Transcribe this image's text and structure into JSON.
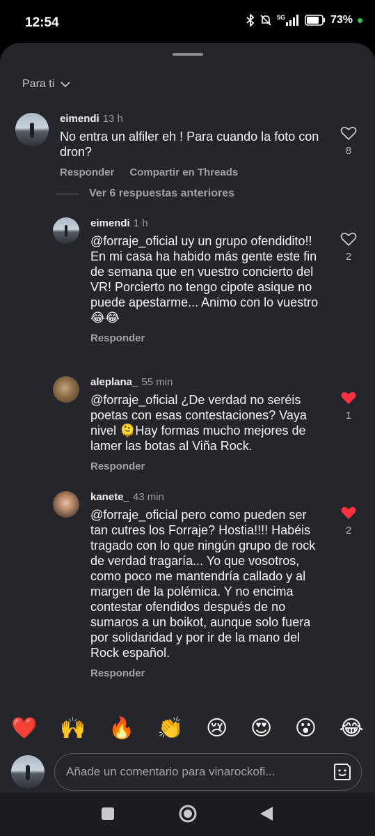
{
  "status": {
    "time": "12:54",
    "battery": "73%",
    "network": "5G"
  },
  "filter": {
    "label": "Para ti"
  },
  "comments": [
    {
      "user": "eimendi",
      "time": "13 h",
      "text": "No entra un alfiler eh ! Para cuando la foto con dron?",
      "reply_label": "Responder",
      "share_label": "Compartir en Threads",
      "likes": "8",
      "liked": false
    }
  ],
  "more_replies": {
    "label": "Ver 6 respuestas anteriores"
  },
  "replies": [
    {
      "user": "eimendi",
      "time": "1 h",
      "mention": "@forraje_oficial",
      "text": " uy un grupo ofendidito!! En mi casa ha habido más gente este fin de semana que en vuestro concierto del VR! Porcierto no tengo cipote asique no puede apestarme... Animo con lo vuestro 😂😂",
      "reply_label": "Responder",
      "likes": "2",
      "liked": false
    },
    {
      "user": "aleplana_",
      "time": "55 min",
      "mention": "@forraje_oficial",
      "text": " ¿De verdad no seréis poetas con esas contestaciones? Vaya nivel 🫠Hay formas mucho mejores de lamer las botas al Viña Rock.",
      "reply_label": "Responder",
      "likes": "1",
      "liked": true
    },
    {
      "user": "kanete_",
      "time": "43 min",
      "mention": "@forraje_oficial",
      "text": " pero como pueden ser tan cutres los Forraje? Hostia!!!! Habéis tragado con lo que ningún grupo de rock de verdad tragaría... Yo que vosotros, como poco me mantendría callado y al margen de la polémica. Y no encima contestar ofendidos después de no sumaros a un boikot, aunque solo fuera por solidaridad y por ir de la mano del Rock español.",
      "reply_label": "Responder",
      "likes": "2",
      "liked": true
    }
  ],
  "emojis": [
    "❤️",
    "🙌",
    "🔥",
    "👏",
    "😢",
    "😍",
    "😮",
    "😂"
  ],
  "composer": {
    "placeholder": "Añade un comentario para vinarockofi..."
  },
  "colors": {
    "background": "#25262b",
    "like_red": "#ff3040",
    "muted_text": "#a0a1a6"
  },
  "icons": [
    "chevron-down-icon",
    "heart-outline-icon",
    "heart-filled-icon",
    "sticker-icon",
    "nav-recents-icon",
    "nav-home-icon",
    "nav-back-icon"
  ]
}
